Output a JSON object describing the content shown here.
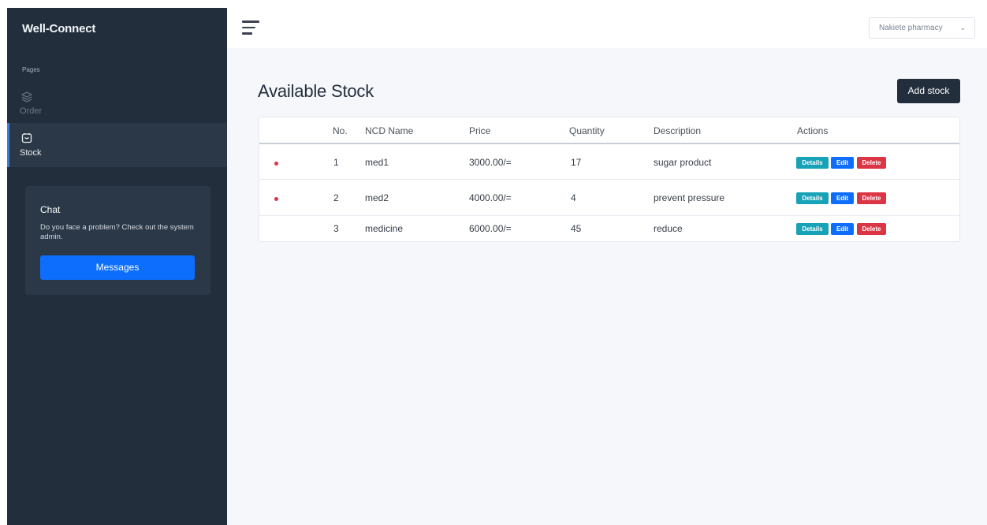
{
  "sidebar": {
    "brand": "Well-Connect",
    "section_label": "Pages",
    "items": [
      {
        "label": "Order",
        "icon": "layers-icon"
      },
      {
        "label": "Stock",
        "icon": "calendar-box-icon"
      }
    ],
    "chat": {
      "title": "Chat",
      "text": "Do you face a problem? Check out the system admin.",
      "button": "Messages"
    }
  },
  "topbar": {
    "menu_icon": "hamburger-menu-icon",
    "pharmacy_select": "Nakiete pharmacy"
  },
  "main": {
    "title": "Available Stock",
    "add_button": "Add stock",
    "table": {
      "headers": [
        "No.",
        "NCD Name",
        "Price",
        "Quantity",
        "Description",
        "Actions"
      ],
      "rows": [
        {
          "no": "1",
          "name": "med1",
          "price": "3000.00/=",
          "quantity": "17",
          "description": "sugar product",
          "low_stock": true
        },
        {
          "no": "2",
          "name": "med2",
          "price": "4000.00/=",
          "quantity": "4",
          "description": "prevent pressure",
          "low_stock": true
        },
        {
          "no": "3",
          "name": "medicine",
          "price": "6000.00/=",
          "quantity": "45",
          "description": "reduce",
          "low_stock": false
        }
      ],
      "actions": {
        "details": "Details",
        "edit": "Edit",
        "delete": "Delete"
      }
    }
  },
  "colors": {
    "sidebar_bg": "#222e3c",
    "accent": "#0d6efd",
    "danger": "#dc3545",
    "info": "#17a2b8",
    "page_bg": "#f5f7fb"
  }
}
